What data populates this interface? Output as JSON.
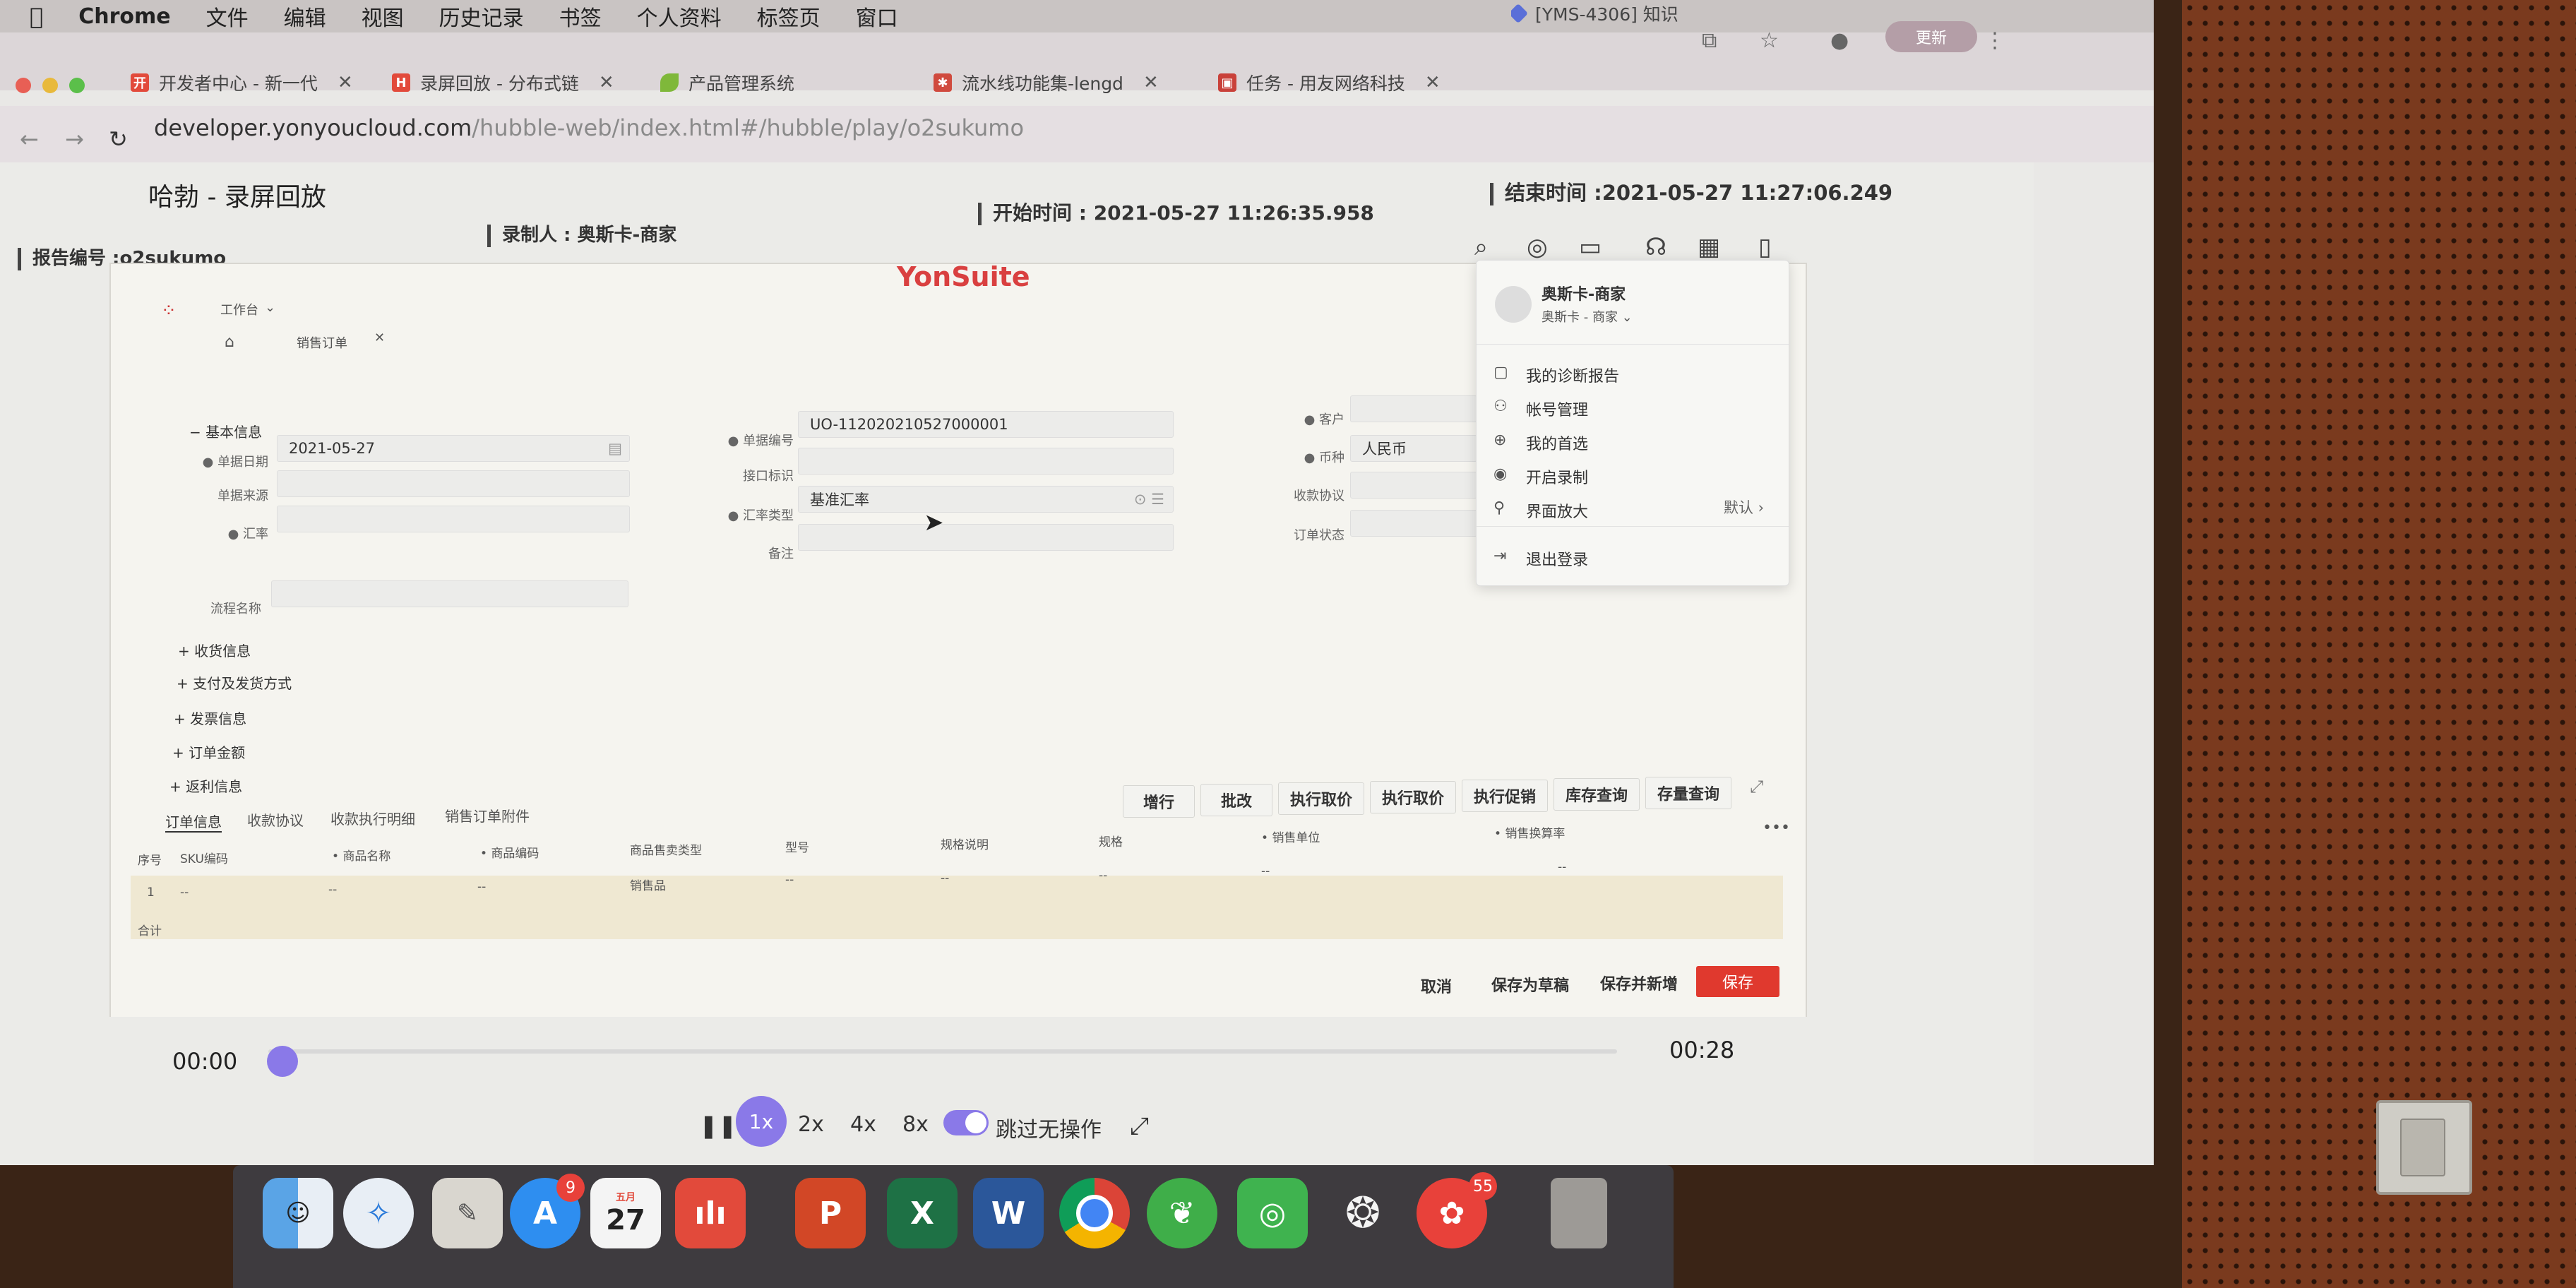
{
  "menubar": {
    "app": "Chrome",
    "items": [
      "文件",
      "编辑",
      "视图",
      "历史记录",
      "书签",
      "个人资料",
      "标签页",
      "窗口"
    ]
  },
  "tabs": [
    {
      "title": "开发者中心 - 新一代",
      "icon": "开"
    },
    {
      "title": "录屏回放 - 分布式链",
      "icon": "H"
    },
    {
      "title": "产品管理系统",
      "icon": "leaf"
    },
    {
      "title": "流水线功能集-lengd",
      "icon": "bug"
    },
    {
      "title": "任务 - 用友网络科技",
      "icon": "task"
    },
    {
      "title": "[YMS-4306] 知识",
      "icon": "diamond"
    }
  ],
  "browser": {
    "url_domain": "developer.yonyoucloud.com",
    "url_path": "/hubble-web/index.html#/hubble/play/o2sukumo",
    "update_label": "更新"
  },
  "hubble": {
    "title": "哈勃 - 录屏回放",
    "report_no": "报告编号 :o2sukumo",
    "recorder": "录制人 : 奥斯卡-商家",
    "start_time": "开始时间 : 2021-05-27 11:26:35.958",
    "end_time": "结束时间 :2021-05-27 11:27:06.249"
  },
  "yonsuite": {
    "logo": "YonSuite",
    "workspace": "工作台",
    "tab": "销售订单",
    "section_basic": "基本信息",
    "fields": {
      "doc_date_label": "单据日期",
      "doc_date": "2021-05-27",
      "doc_source_label": "单据来源",
      "rate_label": "汇率",
      "process_label": "流程名称",
      "doc_no_label": "单据编号",
      "doc_no": "UO-112020210527000001",
      "interface_label": "接口标识",
      "rate_type_label": "汇率类型",
      "rate_type": "基准汇率",
      "remark_label": "备注",
      "customer_label": "客户",
      "currency_label": "币种",
      "currency": "人民币",
      "agreement_label": "收款协议",
      "order_status_label": "订单状态"
    },
    "collapsed_sections": [
      "收货信息",
      "支付及发货方式",
      "发票信息",
      "订单金额",
      "返利信息"
    ],
    "subtabs": [
      "订单信息",
      "收款协议",
      "收款执行明细",
      "销售订单附件"
    ],
    "actions": [
      "增行",
      "批改",
      "执行取价",
      "执行取价",
      "执行促销",
      "库存查询",
      "存量查询"
    ],
    "table": {
      "headers": [
        "序号",
        "SKU编码",
        "商品名称",
        "商品编码",
        "商品售卖类型",
        "型号",
        "规格说明",
        "规格",
        "销售单位",
        "销售换算率"
      ],
      "row": [
        "1",
        "--",
        "--",
        "--",
        "销售品",
        "--",
        "--",
        "--",
        "--",
        "--"
      ],
      "total_label": "合计"
    },
    "footer": {
      "cancel": "取消",
      "save_draft": "保存为草稿",
      "save_new": "保存并新增",
      "save": "保存"
    },
    "user_menu": {
      "name": "奥斯卡-商家",
      "org": "奥斯卡 - 商家",
      "items": [
        "我的诊断报告",
        "帐号管理",
        "我的首选",
        "开启录制",
        "界面放大",
        "退出登录"
      ],
      "zoom_value": "默认"
    }
  },
  "player": {
    "current": "00:00",
    "total": "00:28",
    "progress": 0,
    "speeds": [
      "1x",
      "2x",
      "4x",
      "8x"
    ],
    "active_speed": "1x",
    "skip_label": "跳过无操作",
    "skip_enabled": true
  },
  "dock": {
    "calendar_month": "五月",
    "calendar_day": "27",
    "appstore_badge": "9",
    "app_badge": "55"
  }
}
